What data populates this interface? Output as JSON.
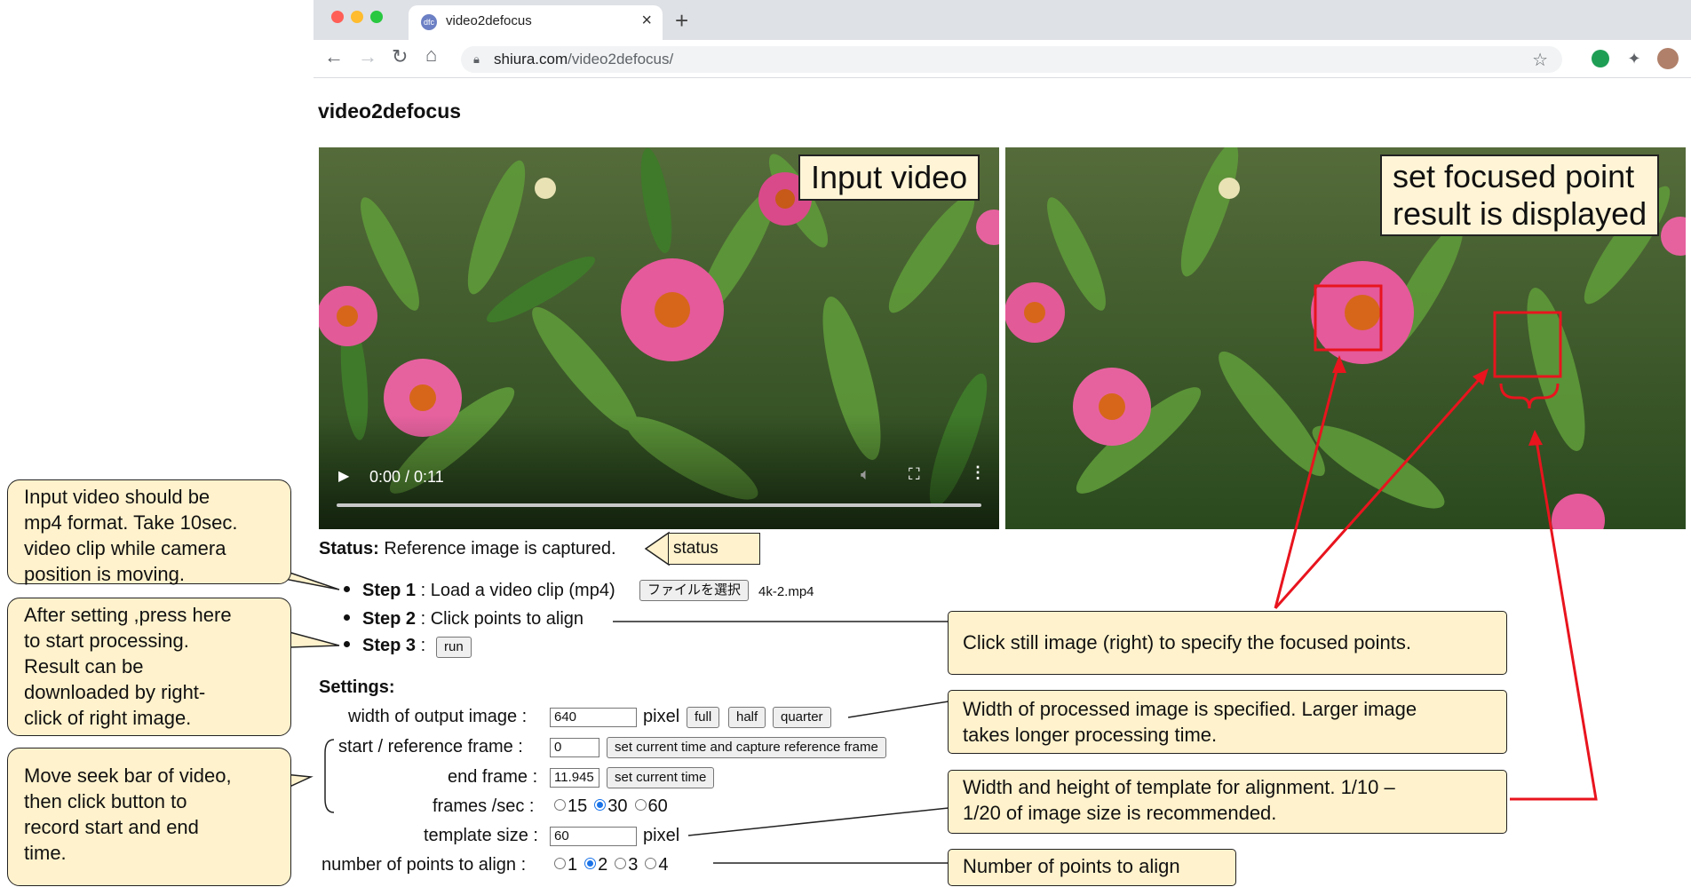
{
  "browser": {
    "tab_title": "video2defocus",
    "url_host": "shiura.com",
    "url_path": "/video2defocus/"
  },
  "page": {
    "title": "video2defocus",
    "left_label": "Input video",
    "right_label_line1": "set focused point",
    "right_label_line2": "result is displayed",
    "video_time": "0:00 / 0:11",
    "status_label": "Status:",
    "status_text": "Reference image is captured.",
    "step1_label": "Step 1",
    "step1_text": ": Load a video clip (mp4)",
    "file_button": "ファイルを選択",
    "file_name": "4k-2.mp4",
    "step2_label": "Step 2",
    "step2_text": ": Click points to align",
    "step3_label": "Step 3",
    "step3_text": ":",
    "run_button": "run",
    "settings_label": "Settings:",
    "width_label": "width of output image :",
    "width_value": "640",
    "pixel_unit": "pixel",
    "full_button": "full",
    "half_button": "half",
    "quarter_button": "quarter",
    "start_label": "start / reference frame :",
    "start_value": "0",
    "capture_button": "set current time and capture reference frame",
    "end_label": "end frame :",
    "end_value": "11.945",
    "set_time_button": "set current time",
    "fps_label": "frames /sec :",
    "fps_options": [
      "15",
      "30",
      "60"
    ],
    "fps_selected": "30",
    "template_label": "template size :",
    "template_value": "60",
    "template_unit": "pixel",
    "points_label": "number of points to align :",
    "points_options": [
      "1",
      "2",
      "3",
      "4"
    ],
    "points_selected": "2"
  },
  "annotations": {
    "input_note": [
      "Input video should be",
      "mp4 format. Take 10sec.",
      "video clip while camera",
      "position is moving."
    ],
    "run_note": [
      "After setting ,press here",
      "to start processing.",
      "Result can be",
      "downloaded by right-",
      "click of right image."
    ],
    "seek_note": [
      "Move seek bar of video,",
      "then click button to",
      "record start and end",
      "time."
    ],
    "status_note": "status",
    "click_note": "Click still image (right) to specify the focused points.",
    "width_note": [
      "Width of processed image  is specified. Larger image",
      "takes longer processing time."
    ],
    "template_note": [
      "Width and height of template for alignment. 1/10 –",
      "1/20 of image size is recommended."
    ],
    "points_note": "Number of points to align"
  },
  "colors": {
    "callout_fill": "#fff2cc",
    "annotation_red": "#e8141e",
    "radio_blue": "#1a73e8"
  }
}
